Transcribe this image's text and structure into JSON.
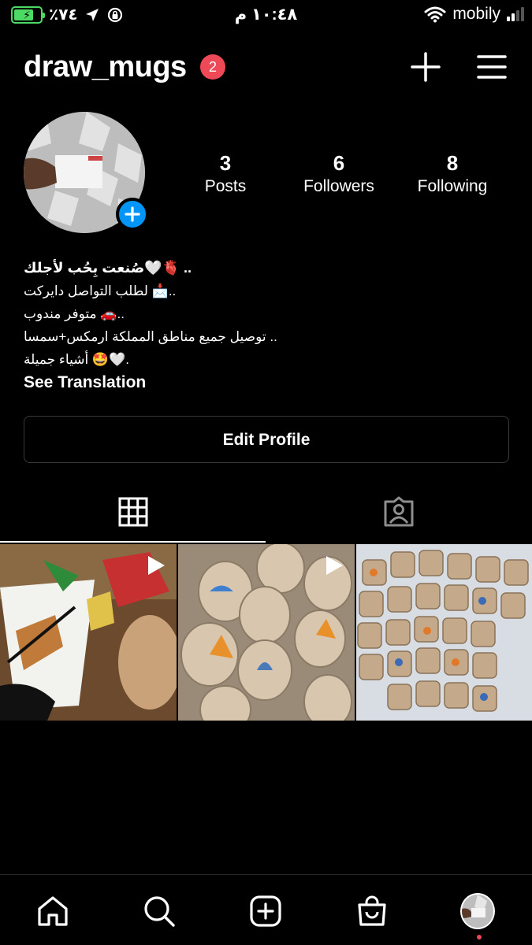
{
  "status_bar": {
    "battery_percent": "٪٧٤",
    "battery_level": 0.74,
    "time": "١٠:٤٨ م",
    "carrier": "mobily",
    "signal_bars": 2,
    "icons": [
      "battery-icon",
      "location-arrow-icon",
      "rotation-lock-icon",
      "wifi-icon",
      "signal-icon"
    ]
  },
  "header": {
    "username": "draw_mugs",
    "notification_count": "2",
    "icons": [
      "plus-icon",
      "menu-icon"
    ]
  },
  "profile": {
    "stats": [
      {
        "value": "3",
        "label": "Posts"
      },
      {
        "value": "6",
        "label": "Followers"
      },
      {
        "value": "8",
        "label": "Following"
      }
    ],
    "bio_lines": [
      "صُنعت بِحُب لأجلك🤍🫀 ..",
      "لطلب التواصل دايركت 📩..",
      "متوفر مندوب 🚗..",
      "توصيل جميع مناطق المملكة ارمكس+سمسا ..",
      "أشياء جميلة 🤩🤍."
    ],
    "see_translation": "See Translation",
    "edit_profile": "Edit Profile"
  },
  "tabs": [
    {
      "name": "posts-grid",
      "icon": "grid-icon",
      "active": true
    },
    {
      "name": "tagged",
      "icon": "tagged-person-icon",
      "active": false
    }
  ],
  "posts": [
    {
      "type": "reel",
      "icon": "reel-play-icon"
    },
    {
      "type": "reel",
      "icon": "reel-play-icon"
    },
    {
      "type": "post"
    }
  ],
  "bottom_nav": {
    "items": [
      "home-icon",
      "search-icon",
      "new-post-icon",
      "shop-icon",
      "profile-avatar"
    ],
    "profile_notification_dot": true
  },
  "colors": {
    "background": "#000000",
    "badge_red": "#ed4956",
    "accent_blue": "#0095f6",
    "battery_green": "#4cd964"
  }
}
